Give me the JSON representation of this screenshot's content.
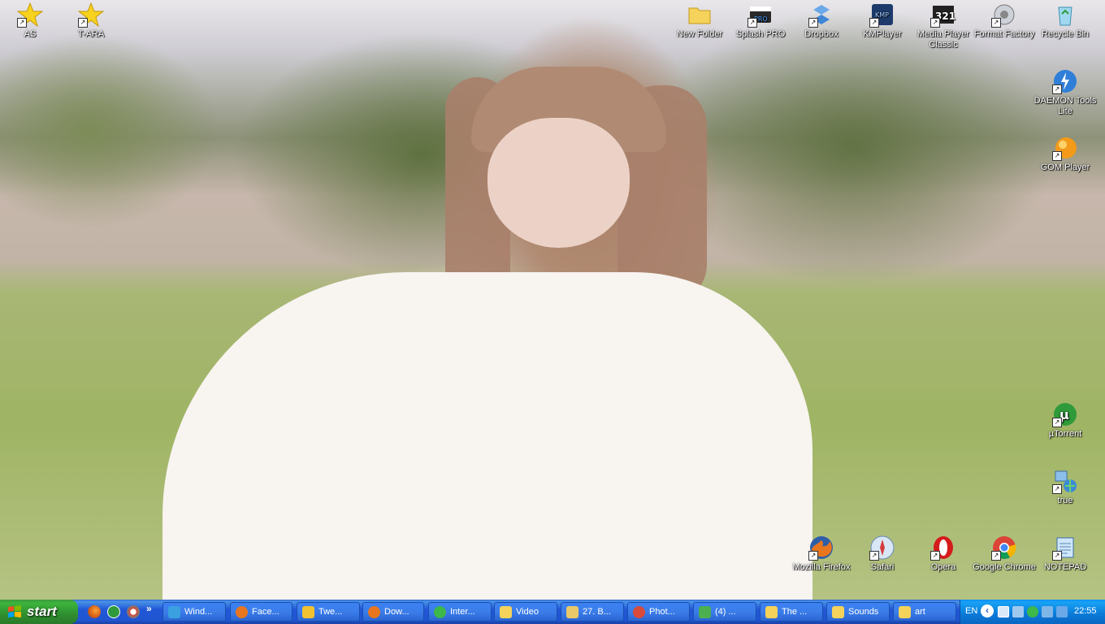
{
  "desktop": {
    "icons": [
      {
        "label": "AS",
        "icon": "star-shortcut-icon"
      },
      {
        "label": "T-ARA",
        "icon": "star-shortcut-icon"
      },
      {
        "label": "New Folder",
        "icon": "folder-icon"
      },
      {
        "label": "Splash PRO",
        "icon": "splash-pro-icon"
      },
      {
        "label": "Dropbox",
        "icon": "dropbox-icon"
      },
      {
        "label": "KMPlayer",
        "icon": "kmplayer-icon"
      },
      {
        "label": "Media Player Classic",
        "icon": "media-player-classic-icon"
      },
      {
        "label": "Format Factory",
        "icon": "format-factory-icon"
      },
      {
        "label": "Recycle Bin",
        "icon": "recycle-bin-icon"
      },
      {
        "label": "DAEMON Tools Lite",
        "icon": "daemon-tools-icon"
      },
      {
        "label": "GOM Player",
        "icon": "gom-player-icon"
      },
      {
        "label": "µTorrent",
        "icon": "utorrent-icon"
      },
      {
        "label": "true",
        "icon": "network-shortcut-icon"
      },
      {
        "label": "Mozilla Firefox",
        "icon": "firefox-icon"
      },
      {
        "label": "Safari",
        "icon": "safari-icon"
      },
      {
        "label": "Opera",
        "icon": "opera-icon"
      },
      {
        "label": "Google Chrome",
        "icon": "chrome-icon"
      },
      {
        "label": "NOTEPAD",
        "icon": "notepad-icon"
      }
    ]
  },
  "taskbar": {
    "start_label": "start",
    "quick_launch": [
      "firefox-icon",
      "utorrent-icon",
      "photoshop-icon"
    ],
    "quick_more": "»",
    "tasks": [
      {
        "label": "Wind...",
        "icon": "windows-live-icon",
        "color": "#3aa0e0"
      },
      {
        "label": "Face...",
        "icon": "firefox-icon",
        "color": "#e8761e"
      },
      {
        "label": "Twe...",
        "icon": "tweetdeck-icon",
        "color": "#f2c230"
      },
      {
        "label": "Dow...",
        "icon": "firefox-icon",
        "color": "#e8761e"
      },
      {
        "label": "Inter...",
        "icon": "network-icon",
        "color": "#3db84a"
      },
      {
        "label": "Video",
        "icon": "folder-icon",
        "color": "#f5d25a"
      },
      {
        "label": "27. B...",
        "icon": "pencil-icon",
        "color": "#e9c86a"
      },
      {
        "label": "Phot...",
        "icon": "photoshop-icon",
        "color": "#d84a3a"
      },
      {
        "label": "(4) ...",
        "icon": "messenger-icon",
        "color": "#4caf50"
      },
      {
        "label": "The ...",
        "icon": "folder-icon",
        "color": "#f5d25a"
      },
      {
        "label": "Sounds",
        "icon": "folder-icon",
        "color": "#f5d25a"
      },
      {
        "label": "art",
        "icon": "folder-icon",
        "color": "#f5d25a"
      }
    ],
    "tray": {
      "language": "EN",
      "show_hidden": "‹",
      "icons": [
        "display-icon",
        "network-status-icon",
        "utorrent-tray-icon",
        "network-connection-icon",
        "dropbox-tray-icon"
      ],
      "clock": "22:55"
    }
  }
}
